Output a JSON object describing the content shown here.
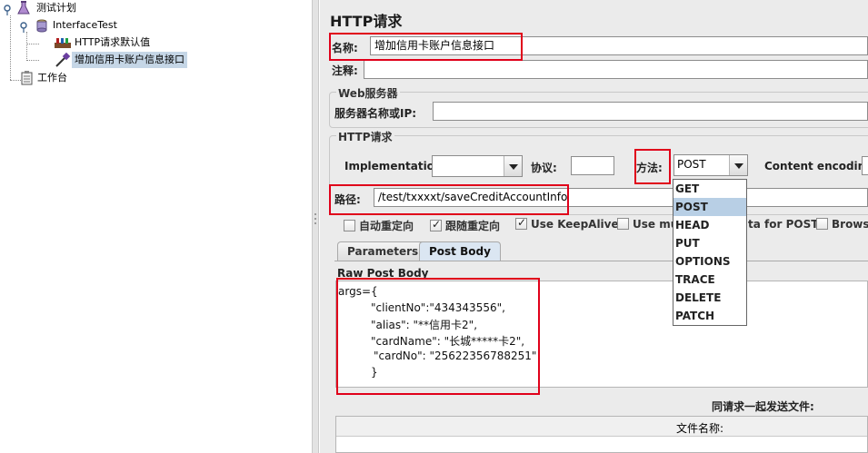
{
  "tree": {
    "plan": "测试计划",
    "thread_group": "InterfaceTest",
    "defaults": "HTTP请求默认值",
    "sampler": "增加信用卡账户信息接口",
    "workbench": "工作台"
  },
  "panel": {
    "title": "HTTP请求",
    "name_label": "名称:",
    "name_value": "增加信用卡账户信息接口",
    "comment_label": "注释:",
    "web_server_group": "Web服务器",
    "server_label": "服务器名称或IP:",
    "http_group": "HTTP请求",
    "impl_label": "Implementation:",
    "protocol_label": "协议:",
    "method_label": "方法:",
    "method_value": "POST",
    "encoding_label": "Content encoding:",
    "path_label": "路径:",
    "path_value": "/test/txxxxt/saveCreditAccountInfo",
    "options": {
      "auto_redirect": "自动重定向",
      "follow_redirect": "跟随重定向",
      "keepalive": "Use KeepAlive",
      "multipart": "Use mul",
      "multipart_tail": "ta for POST",
      "browser": "Browse"
    },
    "tabs": {
      "parameters": "Parameters",
      "post_body": "Post Body"
    },
    "raw_post_body": "Raw Post Body",
    "body_lines": [
      "args={",
      "\"clientNo\":\"434343556\",",
      "\"alias\": \"**信用卡2\",",
      "\"cardName\": \"长城*****卡2\",",
      "\"cardNo\": \"25622356788251\"",
      "}"
    ],
    "send_files_label": "同请求一起发送文件:",
    "file_name_header": "文件名称:"
  },
  "method_dropdown": [
    "GET",
    "POST",
    "HEAD",
    "PUT",
    "OPTIONS",
    "TRACE",
    "DELETE",
    "PATCH"
  ],
  "method_selected": "POST",
  "colors": {
    "highlight_box": "#e0001a",
    "selection": "#b8cfe5",
    "panel_bg": "#ebebeb"
  }
}
